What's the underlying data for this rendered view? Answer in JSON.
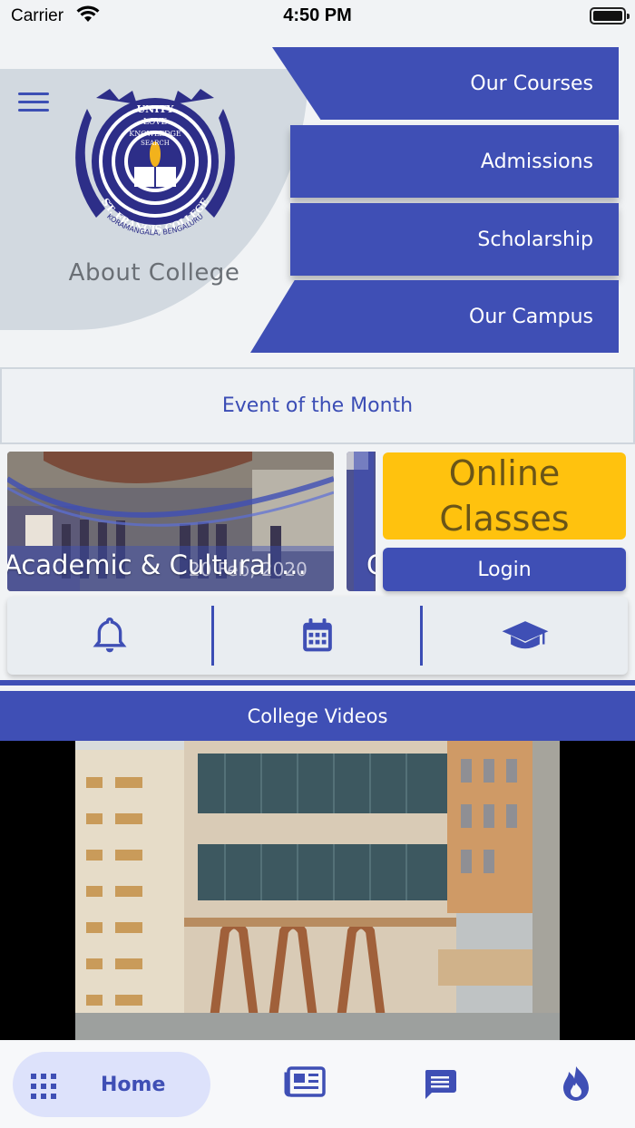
{
  "status": {
    "carrier": "Carrier",
    "time": "4:50 PM"
  },
  "header": {
    "about_label": "About College",
    "logo_text": {
      "motto": [
        "UNITY",
        "LOVE",
        "KNOWLEDGE",
        "SEARCH"
      ],
      "name": "ST. FRANCIS COLLEGE",
      "location": "KORAMANGALA, BENGALURU"
    }
  },
  "nav_tabs": [
    {
      "label": "Our Courses"
    },
    {
      "label": "Admissions"
    },
    {
      "label": "Scholarship"
    },
    {
      "label": "Our Campus"
    }
  ],
  "event": {
    "title": "Event of the Month",
    "slides": [
      {
        "caption": "Academic & Cultural ...",
        "date": "20 Feb, 2020"
      },
      {
        "caption": "C"
      }
    ]
  },
  "online": {
    "title": "Online Classes",
    "login_label": "Login"
  },
  "quick_actions": [
    {
      "icon": "bell-icon"
    },
    {
      "icon": "calendar-icon"
    },
    {
      "icon": "graduation-cap-icon"
    }
  ],
  "videos": {
    "title": "College Videos"
  },
  "bottom_nav": [
    {
      "label": "Home",
      "icon": "grid-icon",
      "active": true
    },
    {
      "icon": "newspaper-icon"
    },
    {
      "icon": "chat-icon"
    },
    {
      "icon": "fire-icon"
    }
  ],
  "colors": {
    "primary": "#3f4fb5",
    "accent": "#ffc20e",
    "header_bg": "#d2d9e0"
  }
}
